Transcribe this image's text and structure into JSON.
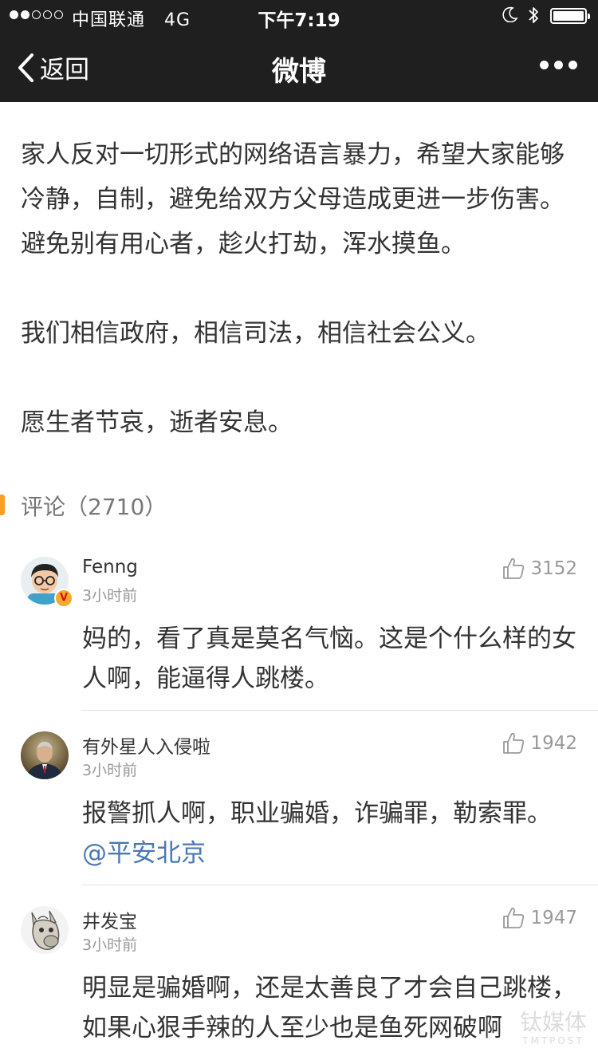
{
  "status_bar": {
    "carrier": "中国联通",
    "network": "4G",
    "time": "下午7:19",
    "signal_bars_filled": 2,
    "signal_bars_total": 5,
    "battery_level": 1.0
  },
  "nav": {
    "back_label": "返回",
    "title": "微博"
  },
  "post": {
    "paragraphs": [
      "家人反对一切形式的网络语言暴力，希望大家能够冷静，自制，避免给双方父母造成更进一步伤害。避免别有用心者，趁火打劫，浑水摸鱼。",
      "我们相信政府，相信司法，相信社会公义。",
      "愿生者节哀，逝者安息。"
    ]
  },
  "comments_section": {
    "label": "评论（2710）",
    "accent_color": "#f89f24"
  },
  "comments": [
    {
      "user": "Fenng",
      "time": "3小时前",
      "likes": "3152",
      "verified": true,
      "avatar": "cartoon-man-glasses",
      "text": "妈的，看了真是莫名气恼。这是个什么样的女人啊，能逼得人跳楼。"
    },
    {
      "user": "有外星人入侵啦",
      "time": "3小时前",
      "likes": "1942",
      "avatar": "man-in-suit-photo",
      "text": "报警抓人啊，职业骗婚，诈骗罪，勒索罪。",
      "mention": "@平安北京"
    },
    {
      "user": "井发宝",
      "time": "3小时前",
      "likes": "1947",
      "avatar": "cartoon-donkey",
      "text": "明显是骗婚啊，还是太善良了才会自己跳楼，如果心狠手辣的人至少也是鱼死网破啊"
    }
  ],
  "watermark": {
    "line1": "钛媒体",
    "line2": "TMTPOST"
  },
  "colors": {
    "topbar": "#1f1f1f",
    "text": "#333333",
    "meta": "#999999",
    "link": "#4a78b5"
  }
}
